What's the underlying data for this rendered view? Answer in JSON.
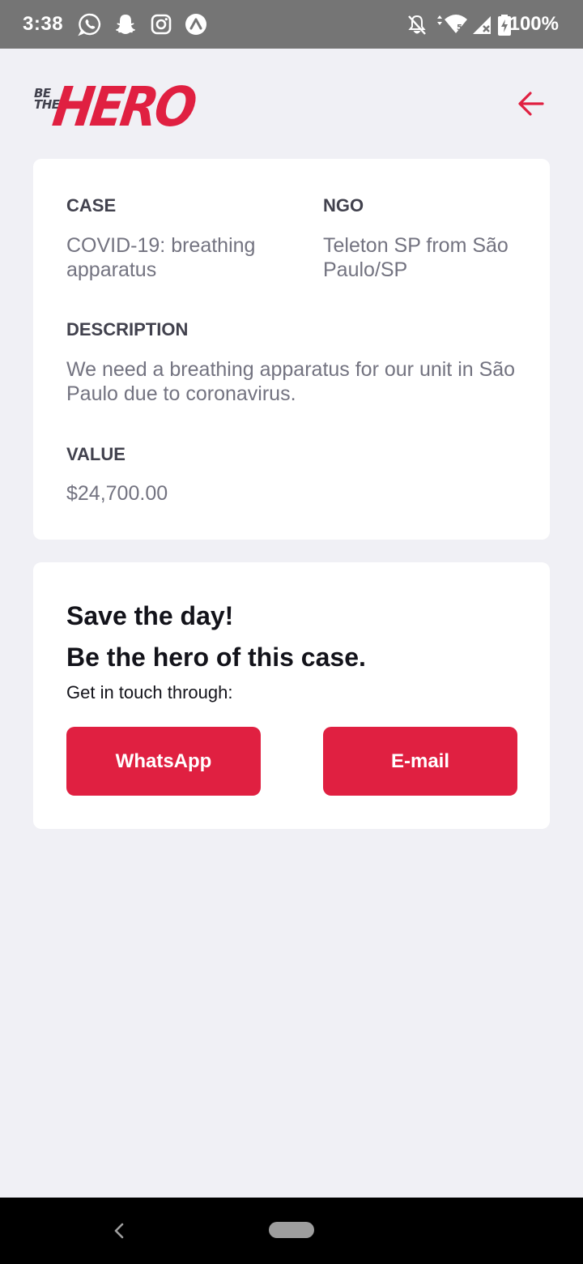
{
  "status_bar": {
    "time": "3:38",
    "battery": "100%",
    "left_icons": [
      "whatsapp-icon",
      "snapchat-icon",
      "instagram-icon",
      "expo-icon"
    ],
    "right_icons": [
      "notifications-off-icon",
      "wifi-icon",
      "signal-icon",
      "battery-icon"
    ]
  },
  "header": {
    "logo_small_line1": "BE",
    "logo_small_line2": "THE",
    "logo_big": "HERO",
    "back_icon": "arrow-left-icon"
  },
  "incident": {
    "case_label": "CASE",
    "case_value": "COVID-19: breathing apparatus",
    "ngo_label": "NGO",
    "ngo_value": "Teleton SP from São Paulo/SP",
    "description_label": "DESCRIPTION",
    "description_value": "We need a breathing apparatus for our unit in São Paulo due to coronavirus.",
    "value_label": "VALUE",
    "value_value": "$24,700.00"
  },
  "contact": {
    "title_line1": "Save the day!",
    "title_line2": "Be the hero of this case.",
    "subtitle": "Get in touch through:",
    "whatsapp_label": "WhatsApp",
    "email_label": "E-mail"
  },
  "colors": {
    "brand_red": "#e02041",
    "background": "#f0f0f5",
    "label": "#41414d",
    "value": "#737380",
    "title": "#13131a"
  }
}
